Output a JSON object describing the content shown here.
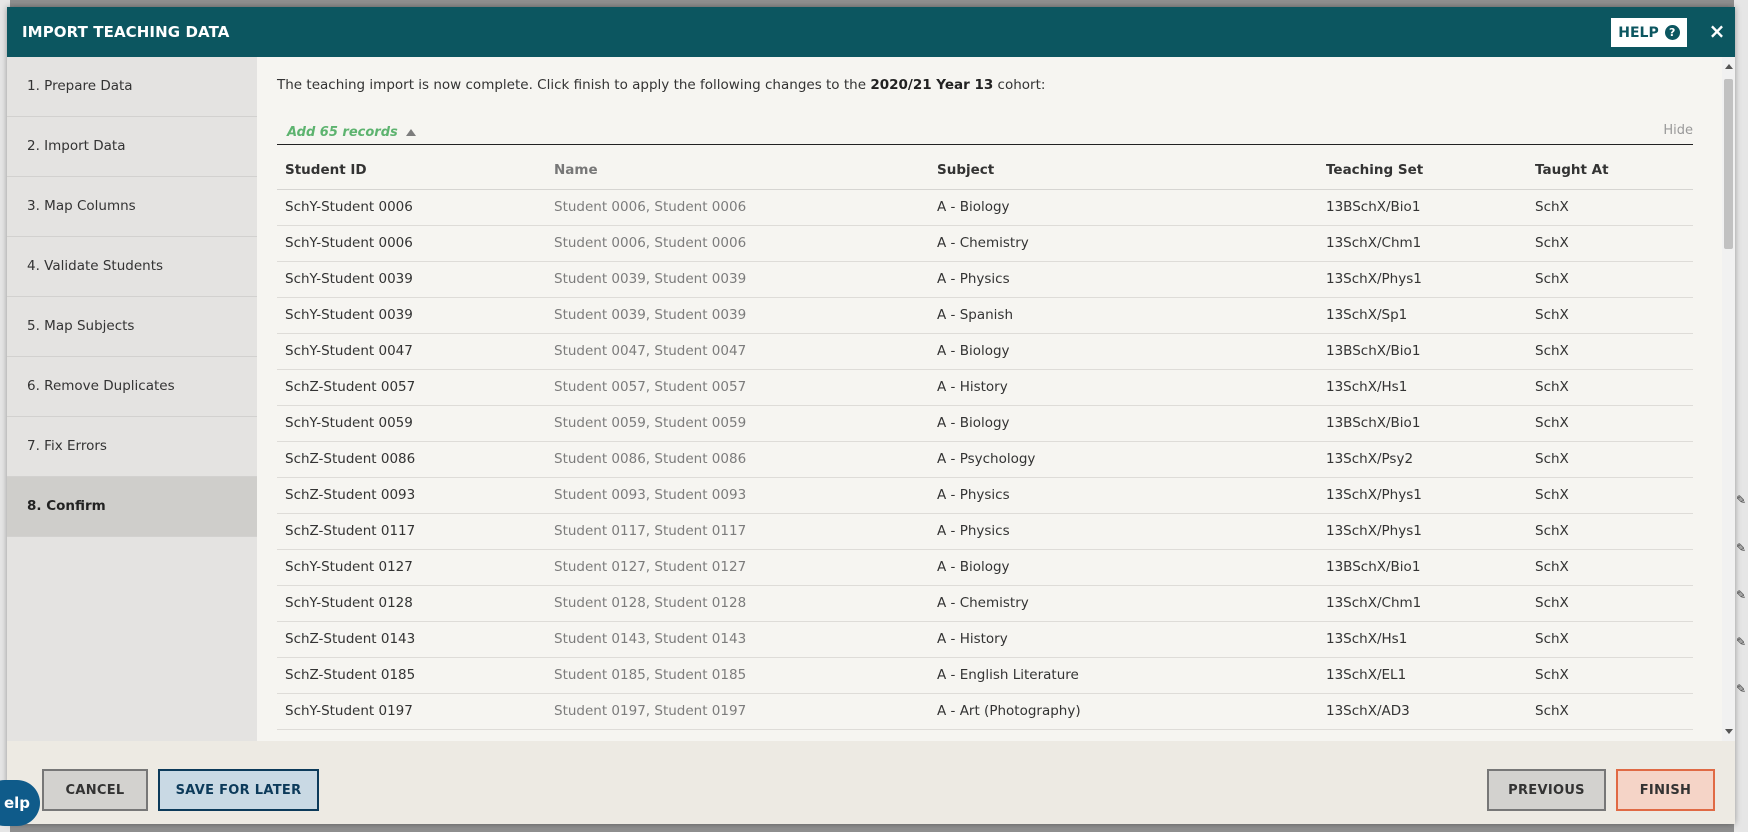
{
  "modal": {
    "title": "IMPORT TEACHING DATA",
    "help_label": "HELP",
    "help_icon": "question-circle-icon",
    "close_glyph": "×"
  },
  "steps": [
    {
      "label": "1. Prepare Data",
      "active": false
    },
    {
      "label": "2. Import Data",
      "active": false
    },
    {
      "label": "3. Map Columns",
      "active": false
    },
    {
      "label": "4. Validate Students",
      "active": false
    },
    {
      "label": "5. Map Subjects",
      "active": false
    },
    {
      "label": "6. Remove Duplicates",
      "active": false
    },
    {
      "label": "7. Fix Errors",
      "active": false
    },
    {
      "label": "8. Confirm",
      "active": true
    }
  ],
  "intro": {
    "prefix": "The teaching import is now complete. Click finish to apply the following changes to the ",
    "cohort": "2020/21 Year 13",
    "suffix": " cohort:"
  },
  "records": {
    "toggle_label": "Add 65 records",
    "hide_label": "Hide"
  },
  "table": {
    "headers": [
      "Student ID",
      "Name",
      "Subject",
      "Teaching Set",
      "Taught At"
    ],
    "rows": [
      [
        "SchY-Student 0006",
        "Student 0006, Student 0006",
        "A - Biology",
        "13BSchX/Bio1",
        "SchX"
      ],
      [
        "SchY-Student 0006",
        "Student 0006, Student 0006",
        "A - Chemistry",
        "13SchX/Chm1",
        "SchX"
      ],
      [
        "SchY-Student 0039",
        "Student 0039, Student 0039",
        "A - Physics",
        "13SchX/Phys1",
        "SchX"
      ],
      [
        "SchY-Student 0039",
        "Student 0039, Student 0039",
        "A - Spanish",
        "13SchX/Sp1",
        "SchX"
      ],
      [
        "SchY-Student 0047",
        "Student 0047, Student 0047",
        "A - Biology",
        "13BSchX/Bio1",
        "SchX"
      ],
      [
        "SchZ-Student 0057",
        "Student 0057, Student 0057",
        "A - History",
        "13SchX/Hs1",
        "SchX"
      ],
      [
        "SchY-Student 0059",
        "Student 0059, Student 0059",
        "A - Biology",
        "13BSchX/Bio1",
        "SchX"
      ],
      [
        "SchZ-Student 0086",
        "Student 0086, Student 0086",
        "A - Psychology",
        "13SchX/Psy2",
        "SchX"
      ],
      [
        "SchZ-Student 0093",
        "Student 0093, Student 0093",
        "A - Physics",
        "13SchX/Phys1",
        "SchX"
      ],
      [
        "SchZ-Student 0117",
        "Student 0117, Student 0117",
        "A - Physics",
        "13SchX/Phys1",
        "SchX"
      ],
      [
        "SchY-Student 0127",
        "Student 0127, Student 0127",
        "A - Biology",
        "13BSchX/Bio1",
        "SchX"
      ],
      [
        "SchY-Student 0128",
        "Student 0128, Student 0128",
        "A - Chemistry",
        "13SchX/Chm1",
        "SchX"
      ],
      [
        "SchZ-Student 0143",
        "Student 0143, Student 0143",
        "A - History",
        "13SchX/Hs1",
        "SchX"
      ],
      [
        "SchZ-Student 0185",
        "Student 0185, Student 0185",
        "A - English Literature",
        "13SchX/EL1",
        "SchX"
      ],
      [
        "SchY-Student 0197",
        "Student 0197, Student 0197",
        "A - Art (Photography)",
        "13SchX/AD3",
        "SchX"
      ]
    ]
  },
  "footer": {
    "cancel_label": "CANCEL",
    "save_label": "SAVE FOR LATER",
    "previous_label": "PREVIOUS",
    "finish_label": "FINISH"
  },
  "help_bubble": {
    "label": "elp"
  },
  "colors": {
    "header_bg": "#0c5660",
    "accent_green": "#5db36f",
    "finish_border": "#e06a45",
    "save_border": "#0c3a5a"
  }
}
